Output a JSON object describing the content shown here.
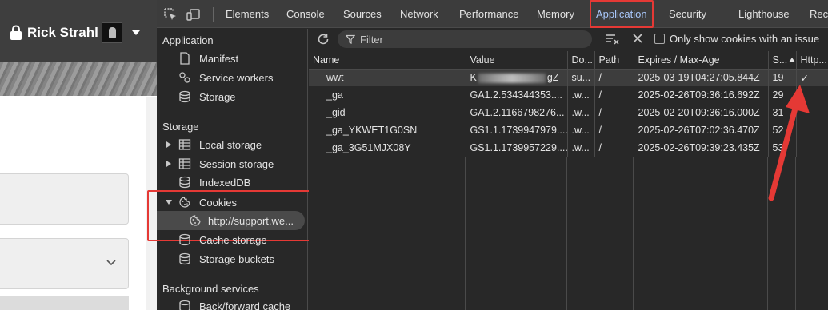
{
  "site": {
    "user_name": "Rick Strahl"
  },
  "devtools": {
    "tabs": [
      "Elements",
      "Console",
      "Sources",
      "Network",
      "Performance",
      "Memory",
      "Application",
      "Security",
      "Lighthouse",
      "Reco"
    ],
    "active_tab": "Application",
    "sidebar": {
      "application_title": "Application",
      "application_items": [
        "Manifest",
        "Service workers",
        "Storage"
      ],
      "storage_title": "Storage",
      "storage_items": [
        "Local storage",
        "Session storage",
        "IndexedDB",
        "Cookies"
      ],
      "cookies_child": "http://support.we...",
      "storage_items_after": [
        "Cache storage",
        "Storage buckets"
      ],
      "background_title": "Background services",
      "background_items": [
        "Back/forward cache"
      ]
    },
    "toolbar": {
      "filter_placeholder": "Filter",
      "only_issue_label": "Only show cookies with an issue"
    },
    "table": {
      "columns": [
        "Name",
        "Value",
        "Do...",
        "Path",
        "Expires / Max-Age",
        "S...",
        "Http..."
      ],
      "rows": [
        {
          "name": "wwt",
          "value_prefix": "K",
          "value_suffix": "gZ",
          "domain": "su...",
          "path": "/",
          "expires": "2025-03-19T04:27:05.844Z",
          "size": "19",
          "http": "✓"
        },
        {
          "name": "_ga",
          "value": "GA1.2.534344353....",
          "domain": ".w...",
          "path": "/",
          "expires": "2025-02-26T09:36:16.692Z",
          "size": "29",
          "http": ""
        },
        {
          "name": "_gid",
          "value": "GA1.2.1166798276...",
          "domain": ".w...",
          "path": "/",
          "expires": "2025-02-20T09:36:16.000Z",
          "size": "31",
          "http": ""
        },
        {
          "name": "_ga_YKWET1G0SN",
          "value": "GS1.1.1739947979....",
          "domain": ".w...",
          "path": "/",
          "expires": "2025-02-26T07:02:36.470Z",
          "size": "52",
          "http": ""
        },
        {
          "name": "_ga_3G51MJX08Y",
          "value": "GS1.1.1739957229....",
          "domain": ".w...",
          "path": "/",
          "expires": "2025-02-26T09:39:23.435Z",
          "size": "53",
          "http": ""
        }
      ]
    },
    "colors": {
      "highlight": "#e53935",
      "active_tab": "#a8c7fa",
      "panel_bg": "#282828"
    }
  }
}
